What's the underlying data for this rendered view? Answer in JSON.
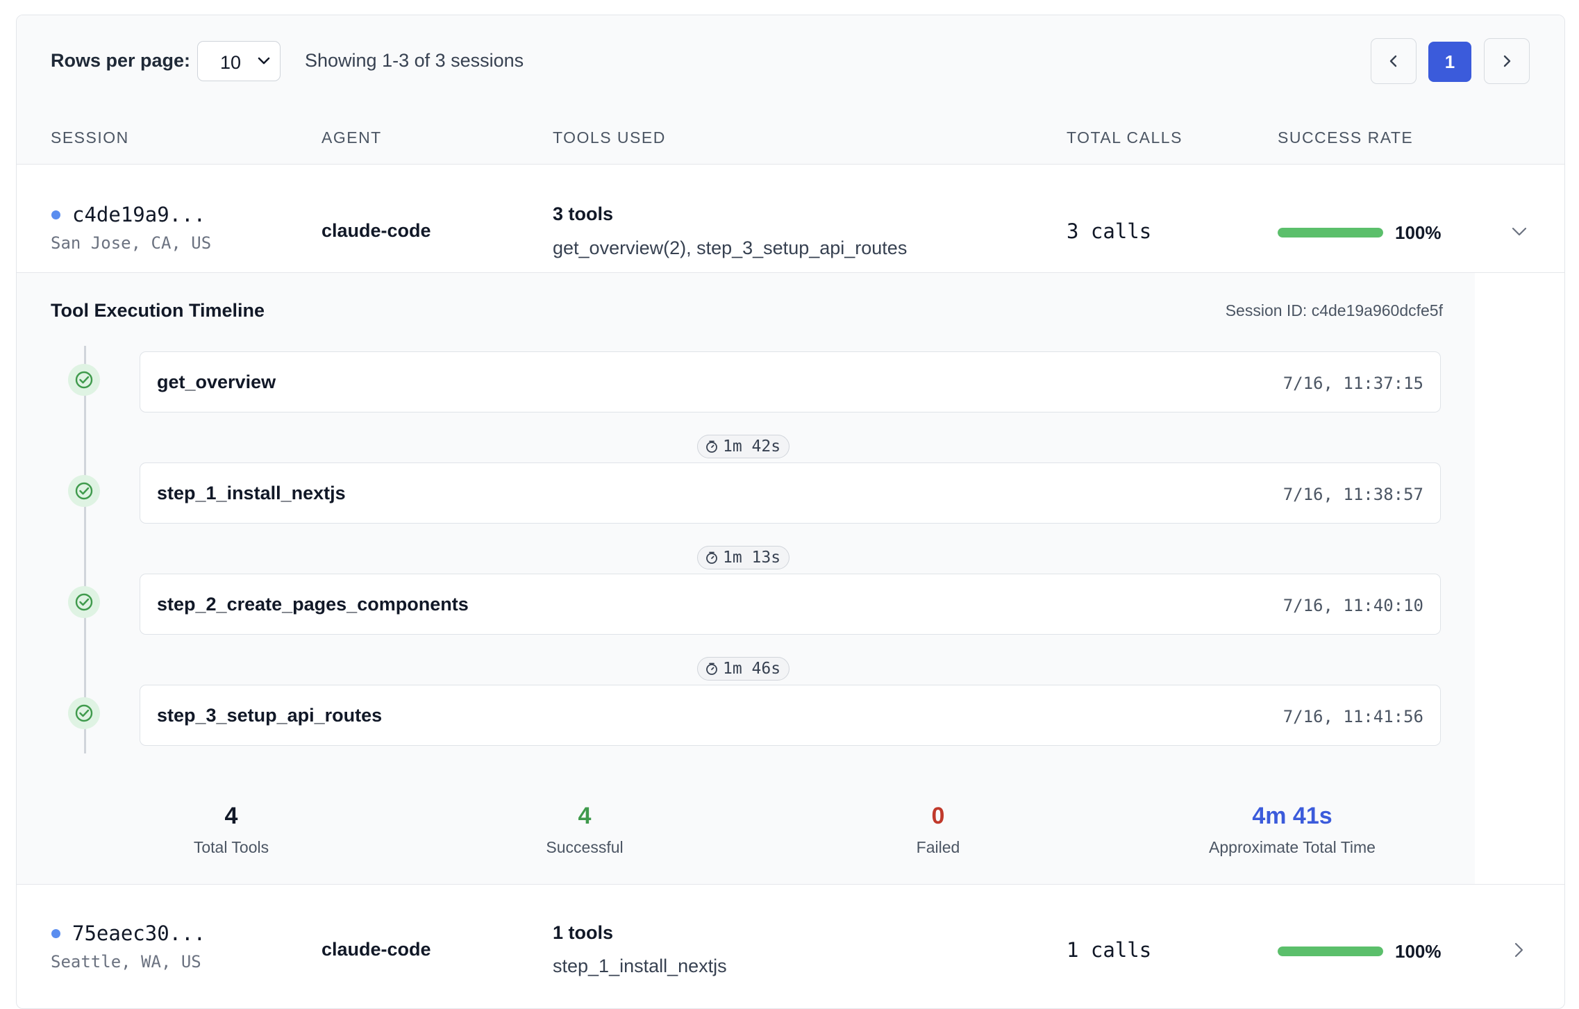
{
  "pagination": {
    "rows_label": "Rows per page:",
    "rows_value": "10",
    "showing": "Showing 1-3 of 3 sessions",
    "current_page": "1"
  },
  "columns": [
    "SESSION",
    "AGENT",
    "TOOLS USED",
    "TOTAL CALLS",
    "SUCCESS RATE"
  ],
  "sessions": [
    {
      "id_short": "c4de19a9...",
      "location": "San Jose, CA, US",
      "agent": "claude-code",
      "tools_count": "3 tools",
      "tools_names": "get_overview(2), step_3_setup_api_routes",
      "calls": "3 calls",
      "success_rate": "100%",
      "success_fraction": 1.0,
      "expanded": true
    },
    {
      "id_short": "75eaec30...",
      "location": "Seattle, WA, US",
      "agent": "claude-code",
      "tools_count": "1 tools",
      "tools_names": "step_1_install_nextjs",
      "calls": "1 calls",
      "success_rate": "100%",
      "success_fraction": 1.0,
      "expanded": false
    }
  ],
  "timeline": {
    "title": "Tool Execution Timeline",
    "session_id": "Session ID: c4de19a960dcfe5f",
    "steps": [
      {
        "name": "get_overview",
        "time": "7/16, 11:37:15"
      },
      {
        "name": "step_1_install_nextjs",
        "time": "7/16, 11:38:57"
      },
      {
        "name": "step_2_create_pages_components",
        "time": "7/16, 11:40:10"
      },
      {
        "name": "step_3_setup_api_routes",
        "time": "7/16, 11:41:56"
      }
    ],
    "durations": [
      "1m 42s",
      "1m 13s",
      "1m 46s"
    ],
    "stats": [
      {
        "value": "4",
        "label": "Total Tools",
        "color": "#111827"
      },
      {
        "value": "4",
        "label": "Successful",
        "color": "#3f9a4c"
      },
      {
        "value": "0",
        "label": "Failed",
        "color": "#c0392b"
      },
      {
        "value": "4m 41s",
        "label": "Approximate Total Time",
        "color": "#3b5bdb"
      }
    ]
  },
  "colors": {
    "accent": "#3b5bdb",
    "success_bar": "#5bbf6b",
    "status_dot": "#5a8def",
    "check_bg": "#dff3e3",
    "check": "#3f9a4c"
  },
  "icons": [
    "chevron-down-icon",
    "chevron-left-icon",
    "chevron-right-icon",
    "check-circle-icon",
    "stopwatch-icon"
  ]
}
